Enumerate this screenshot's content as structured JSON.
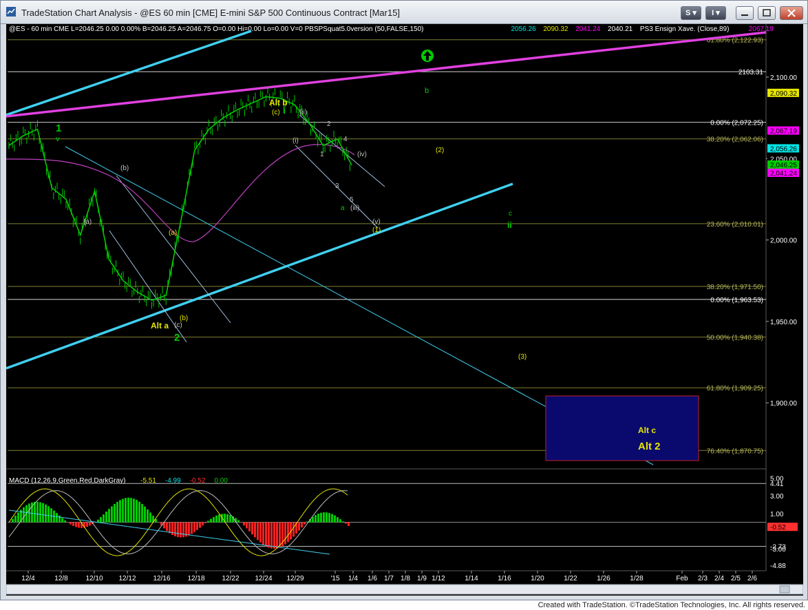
{
  "window": {
    "title": "TradeStation Chart Analysis - @ES 60 min [CME] E-mini S&P 500 Continuous Contract [Mar15]",
    "buttons": {
      "s_label": "S",
      "i_label": "I"
    }
  },
  "header_items": [
    {
      "text": "@ES - 60 min  CME  L=2046.25  0.00  0.00%  B=2046.25  A=2046.75  O=0.00  Hi=0.00  Lo=0.00  V=0  PBSPSquat5.0version (50,FALSE,150)",
      "color": "#ffffff"
    },
    {
      "text": "2056.26",
      "color": "#00e5e5"
    },
    {
      "text": "2090.32",
      "color": "#e6e600"
    },
    {
      "text": "2041.24",
      "color": "#ff00ff"
    },
    {
      "text": "2040.21",
      "color": "#ffffff"
    },
    {
      "text": "PS3 Ensign Xave. (Close,89)",
      "color": "#ffffff"
    },
    {
      "text": "2067.19",
      "color": "#ff00ff"
    }
  ],
  "macd_header": [
    {
      "text": "MACD (12,26,9,Green,Red,DarkGray)",
      "color": "#ffffff"
    },
    {
      "text": "-5.51",
      "color": "#e6e600"
    },
    {
      "text": "-4.99",
      "color": "#00e5e5"
    },
    {
      "text": "-0.52",
      "color": "#ff3030"
    },
    {
      "text": "0.00",
      "color": "#00cc00"
    }
  ],
  "chart_data": {
    "type": "line",
    "instrument": "@ES 60 min [CME] E-mini S&P 500 Continuous Contract [Mar15]",
    "price_axis": {
      "ylim": [
        1862,
        2130
      ],
      "tick_labels": [
        "2,100.00",
        "2,050.00",
        "2,000.00",
        "1,950.00",
        "1,900.00"
      ],
      "ticks": [
        2100,
        2050,
        2000,
        1950,
        1900
      ]
    },
    "x_tick_labels": [
      "12/4",
      "12/8",
      "12/10",
      "12/12",
      "12/16",
      "12/18",
      "12/22",
      "12/24",
      "12/29",
      "'15",
      "1/4",
      "1/6",
      "1/7",
      "1/8",
      "1/9",
      "1/12",
      "1/14",
      "1/16",
      "1/20",
      "1/22",
      "1/26",
      "1/28",
      "Feb",
      "2/3",
      "2/4",
      "2/5",
      "2/6"
    ],
    "price_series": {
      "name": "@ES",
      "points": [
        [
          "12/4",
          2058
        ],
        [
          "12/5",
          2064
        ],
        [
          "12/8",
          2068
        ],
        [
          "12/9",
          2032
        ],
        [
          "12/10",
          2025
        ],
        [
          "12/10b",
          2003
        ],
        [
          "12/11",
          2030
        ],
        [
          "12/12",
          1988
        ],
        [
          "12/15",
          1975
        ],
        [
          "12/16",
          1968
        ],
        [
          "12/16b",
          1963
        ],
        [
          "12/17",
          1966
        ],
        [
          "12/17b",
          2010
        ],
        [
          "12/18",
          2055
        ],
        [
          "12/19",
          2068
        ],
        [
          "12/22",
          2075
        ],
        [
          "12/23",
          2080
        ],
        [
          "12/24",
          2084
        ],
        [
          "12/26",
          2088
        ],
        [
          "12/29",
          2087
        ],
        [
          "12/30",
          2083
        ],
        [
          "12/31",
          2072
        ],
        [
          "1/2",
          2058
        ],
        [
          "1/2b",
          2062
        ],
        [
          "1/4",
          2046
        ]
      ]
    },
    "fib_levels": [
      {
        "label": "61.80% (2,122.93)",
        "value": 2122.93
      },
      {
        "label": "2103.31",
        "value": 2103.31
      },
      {
        "label": "0.00% (2,072.25)",
        "value": 2072.25
      },
      {
        "label": "38.20% (2,062.06)",
        "value": 2062.06
      },
      {
        "label": "23.60% (2,010.01)",
        "value": 2010.01
      },
      {
        "label": "38.20% (1,971.50)",
        "value": 1971.5
      },
      {
        "label": "0.00% (1,963.53)",
        "value": 1963.53
      },
      {
        "label": "50.00% (1,940.38)",
        "value": 1940.38
      },
      {
        "label": "61.80% (1,909.25)",
        "value": 1909.25
      },
      {
        "label": "76.40% (1,870.75)",
        "value": 1870.75
      }
    ],
    "price_flags": [
      {
        "value": 2090.32,
        "label": "2,090.32",
        "bg": "#e6e600",
        "fg": "#000000"
      },
      {
        "value": 2067.19,
        "label": "2,067.19",
        "bg": "#ff00ff",
        "fg": "#000000"
      },
      {
        "value": 2056.26,
        "label": "2,056.26",
        "bg": "#00e5e5",
        "fg": "#000000"
      },
      {
        "value": 2050,
        "label": "2,050.00",
        "bg": "#000000",
        "fg": "#ffffff"
      },
      {
        "value": 2046.25,
        "label": "2,046.25",
        "bg": "#00cc00",
        "fg": "#000000"
      },
      {
        "value": 2041.24,
        "label": "2,041.24",
        "bg": "#ff00ff",
        "fg": "#000000"
      }
    ],
    "wave_labels": [
      {
        "text": "1",
        "color": "#00cc00"
      },
      {
        "text": "v",
        "color": "#00cc00"
      },
      {
        "text": "(a)",
        "color": "#c0c0c0"
      },
      {
        "text": "(b)",
        "color": "#c0c0c0"
      },
      {
        "text": "(a)",
        "color": "#e6e600"
      },
      {
        "text": "Alt a",
        "color": "#e6e600"
      },
      {
        "text": "(c)",
        "color": "#c0c0c0"
      },
      {
        "text": "(b)",
        "color": "#e6e600"
      },
      {
        "text": "2",
        "color": "#00cc00"
      },
      {
        "text": "Alt b",
        "color": "#e6e600"
      },
      {
        "text": "(c)",
        "color": "#e6e600"
      },
      {
        "text": "i",
        "color": "#00cc00"
      },
      {
        "text": "(ii)",
        "color": "#c0c0c0"
      },
      {
        "text": "(i)",
        "color": "#c0c0c0"
      },
      {
        "text": "2",
        "color": "#c0c0c0"
      },
      {
        "text": "1",
        "color": "#c0c0c0"
      },
      {
        "text": "4",
        "color": "#c0c0c0"
      },
      {
        "text": "(iv)",
        "color": "#c0c0c0"
      },
      {
        "text": "3",
        "color": "#c0c0c0"
      },
      {
        "text": "5",
        "color": "#c0c0c0"
      },
      {
        "text": "a",
        "color": "#00cc00"
      },
      {
        "text": "(iii)",
        "color": "#c0c0c0"
      },
      {
        "text": "(v)",
        "color": "#c0c0c0"
      },
      {
        "text": "(1)",
        "color": "#e6e600"
      },
      {
        "text": "b",
        "color": "#00cc00"
      },
      {
        "text": "(2)",
        "color": "#e6e600"
      },
      {
        "text": "c",
        "color": "#00cc00"
      },
      {
        "text": "ii",
        "color": "#00cc00"
      },
      {
        "text": "(3)",
        "color": "#e6e600"
      },
      {
        "text": "Alt c",
        "color": "#e6e600"
      },
      {
        "text": "Alt 2",
        "color": "#e6e600"
      }
    ],
    "macd": {
      "name": "MACD (12,26,9,Green,Red,DarkGray)",
      "ylim": [
        -5.2,
        5.6
      ],
      "tick_labels": [
        "4.41",
        "5.00",
        "3.00",
        "1.00",
        "-0.52",
        "-2.73",
        "-3.00",
        "-4.88"
      ],
      "ticks": [
        4.41,
        5.0,
        3.0,
        1.0,
        -0.52,
        -2.73,
        -3.0,
        -4.88
      ],
      "values": {
        "macd": -5.51,
        "signal": -4.99,
        "histogram": -0.52,
        "zero": 0.0
      }
    },
    "colors": {
      "background": "#000000",
      "up_bar": "#00cc00",
      "macd_hist_up": "#00cc00",
      "macd_hist_down": "#ff2020",
      "channel": "#40d0f0",
      "ensign_avg": "#ff00ff"
    }
  },
  "footer": {
    "text": "Created with TradeStation. ©TradeStation Technologies, Inc. All rights reserved."
  }
}
